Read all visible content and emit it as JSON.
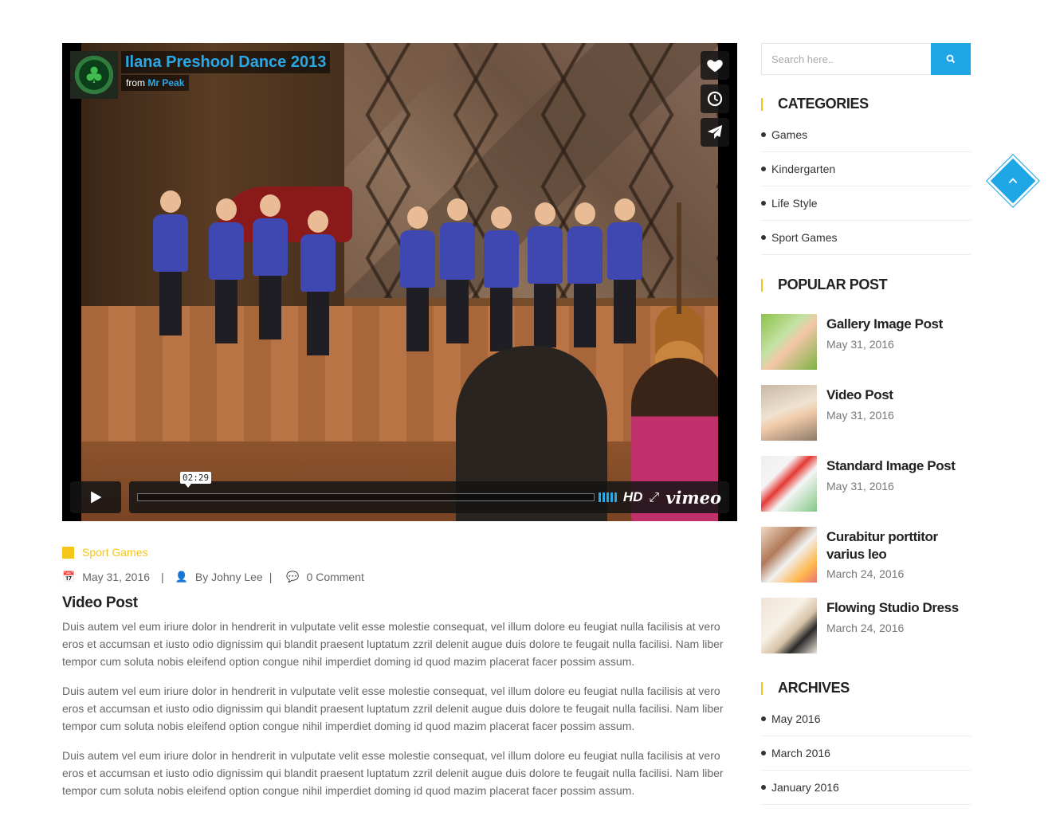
{
  "video": {
    "title": "Ilana Preshool Dance 2013",
    "by_prefix": "from",
    "author": "Mr Peak",
    "time": "02:29",
    "hd_label": "HD",
    "brand": "vimeo"
  },
  "post": {
    "category": "Sport Games",
    "date": "May 31, 2016",
    "author": "By Johny Lee",
    "comments": "0 Comment",
    "title": "Video Post",
    "paragraphs": [
      "Duis autem vel eum iriure dolor in hendrerit in vulputate velit esse molestie consequat, vel illum dolore eu feugiat nulla facilisis at vero eros et accumsan et iusto odio dignissim qui blandit praesent luptatum zzril delenit augue duis dolore te feugait nulla facilisi. Nam liber tempor cum soluta nobis eleifend option congue nihil imperdiet doming id quod mazim placerat facer possim assum.",
      "Duis autem vel eum iriure dolor in hendrerit in vulputate velit esse molestie consequat, vel illum dolore eu feugiat nulla facilisis at vero eros et accumsan et iusto odio dignissim qui blandit praesent luptatum zzril delenit augue duis dolore te feugait nulla facilisi. Nam liber tempor cum soluta nobis eleifend option congue nihil imperdiet doming id quod mazim placerat facer possim assum.",
      "Duis autem vel eum iriure dolor in hendrerit in vulputate velit esse molestie consequat, vel illum dolore eu feugiat nulla facilisis at vero eros et accumsan et iusto odio dignissim qui blandit praesent luptatum zzril delenit augue duis dolore te feugait nulla facilisi. Nam liber tempor cum soluta nobis eleifend option congue nihil imperdiet doming id quod mazim placerat facer possim assum."
    ]
  },
  "sidebar": {
    "search_placeholder": "Search here..",
    "categories": {
      "title": "CATEGORIES",
      "items": [
        "Games",
        "Kindergarten",
        "Life Style",
        "Sport Games"
      ]
    },
    "popular": {
      "title": "POPULAR POST",
      "items": [
        {
          "title": "Gallery Image Post",
          "date": "May 31, 2016"
        },
        {
          "title": "Video Post",
          "date": "May 31, 2016"
        },
        {
          "title": "Standard Image Post",
          "date": "May 31, 2016"
        },
        {
          "title": "Curabitur porttitor varius leo",
          "date": "March 24, 2016"
        },
        {
          "title": "Flowing Studio Dress",
          "date": "March 24, 2016"
        }
      ]
    },
    "archives": {
      "title": "ARCHIVES",
      "items": [
        "May 2016",
        "March 2016",
        "January 2016"
      ]
    }
  },
  "colors": {
    "accent_blue": "#1fa6e6",
    "accent_yellow": "#f5c518",
    "vimeo_blue": "#2aa8e6"
  },
  "icons": {
    "like": "heart-icon",
    "watch_later": "clock-icon",
    "share": "paper-plane-icon",
    "play": "play-icon",
    "search": "search-icon",
    "calendar": "calendar-icon",
    "user": "user-icon",
    "comment": "comment-icon",
    "back_to_top": "chevron-up-icon"
  }
}
